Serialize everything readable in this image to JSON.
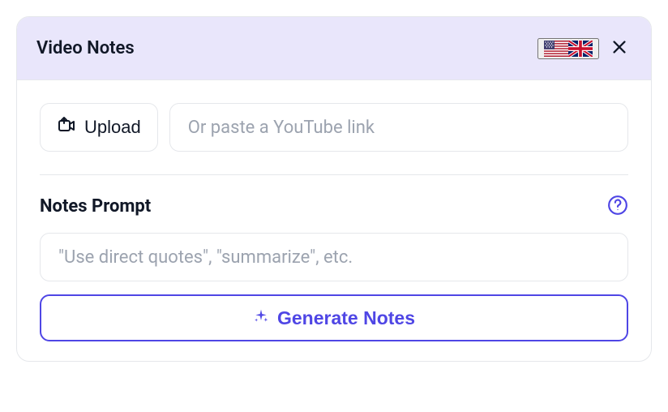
{
  "header": {
    "title": "Video Notes",
    "locales": [
      "us",
      "gb"
    ]
  },
  "upload": {
    "button_label": "Upload",
    "link_placeholder": "Or paste a YouTube link",
    "link_value": ""
  },
  "prompt": {
    "section_title": "Notes Prompt",
    "placeholder": "\"Use direct quotes\", \"summarize\", etc.",
    "value": ""
  },
  "generate": {
    "label": "Generate Notes"
  },
  "icons": {
    "upload": "video-upload-icon",
    "close": "close-icon",
    "help": "help-icon",
    "sparkle": "sparkles-icon"
  },
  "colors": {
    "accent": "#4f46e5",
    "header_bg": "#e9e6fb",
    "border": "#e5e7eb",
    "placeholder": "#9ca3af",
    "text": "#111827"
  }
}
